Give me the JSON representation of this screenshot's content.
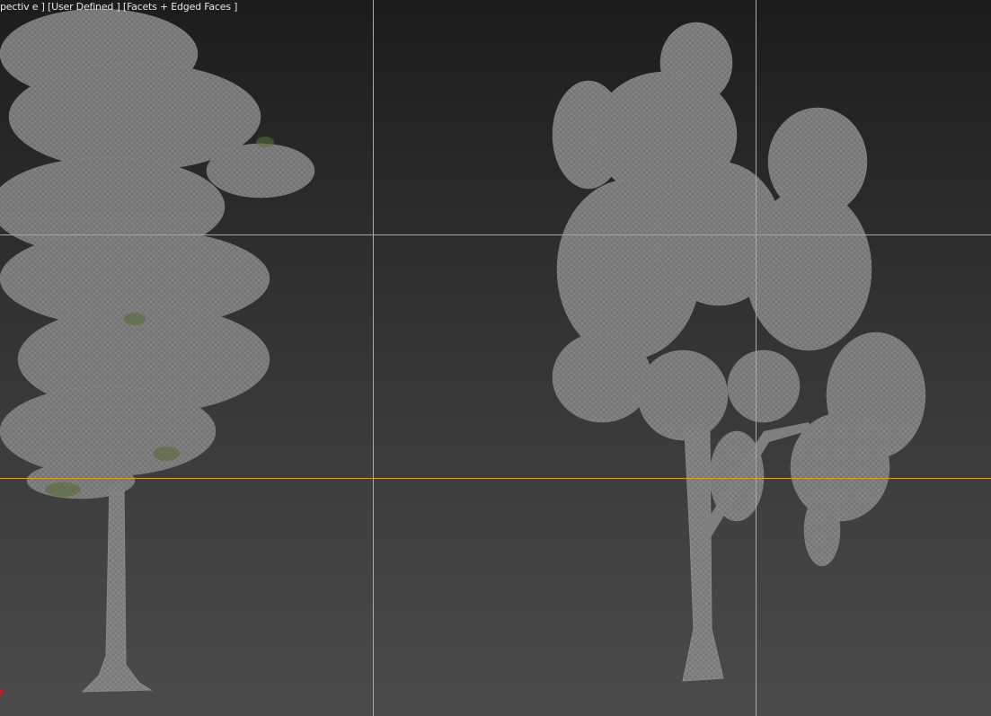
{
  "viewport": {
    "label": "pectiv e ] [User Defined ] [Facets + Edged Faces ]",
    "guide_colors": {
      "vertical": "#3fd6d6",
      "horizontal": "#d8a030"
    },
    "objects": [
      "tree-left",
      "tree-right"
    ]
  }
}
